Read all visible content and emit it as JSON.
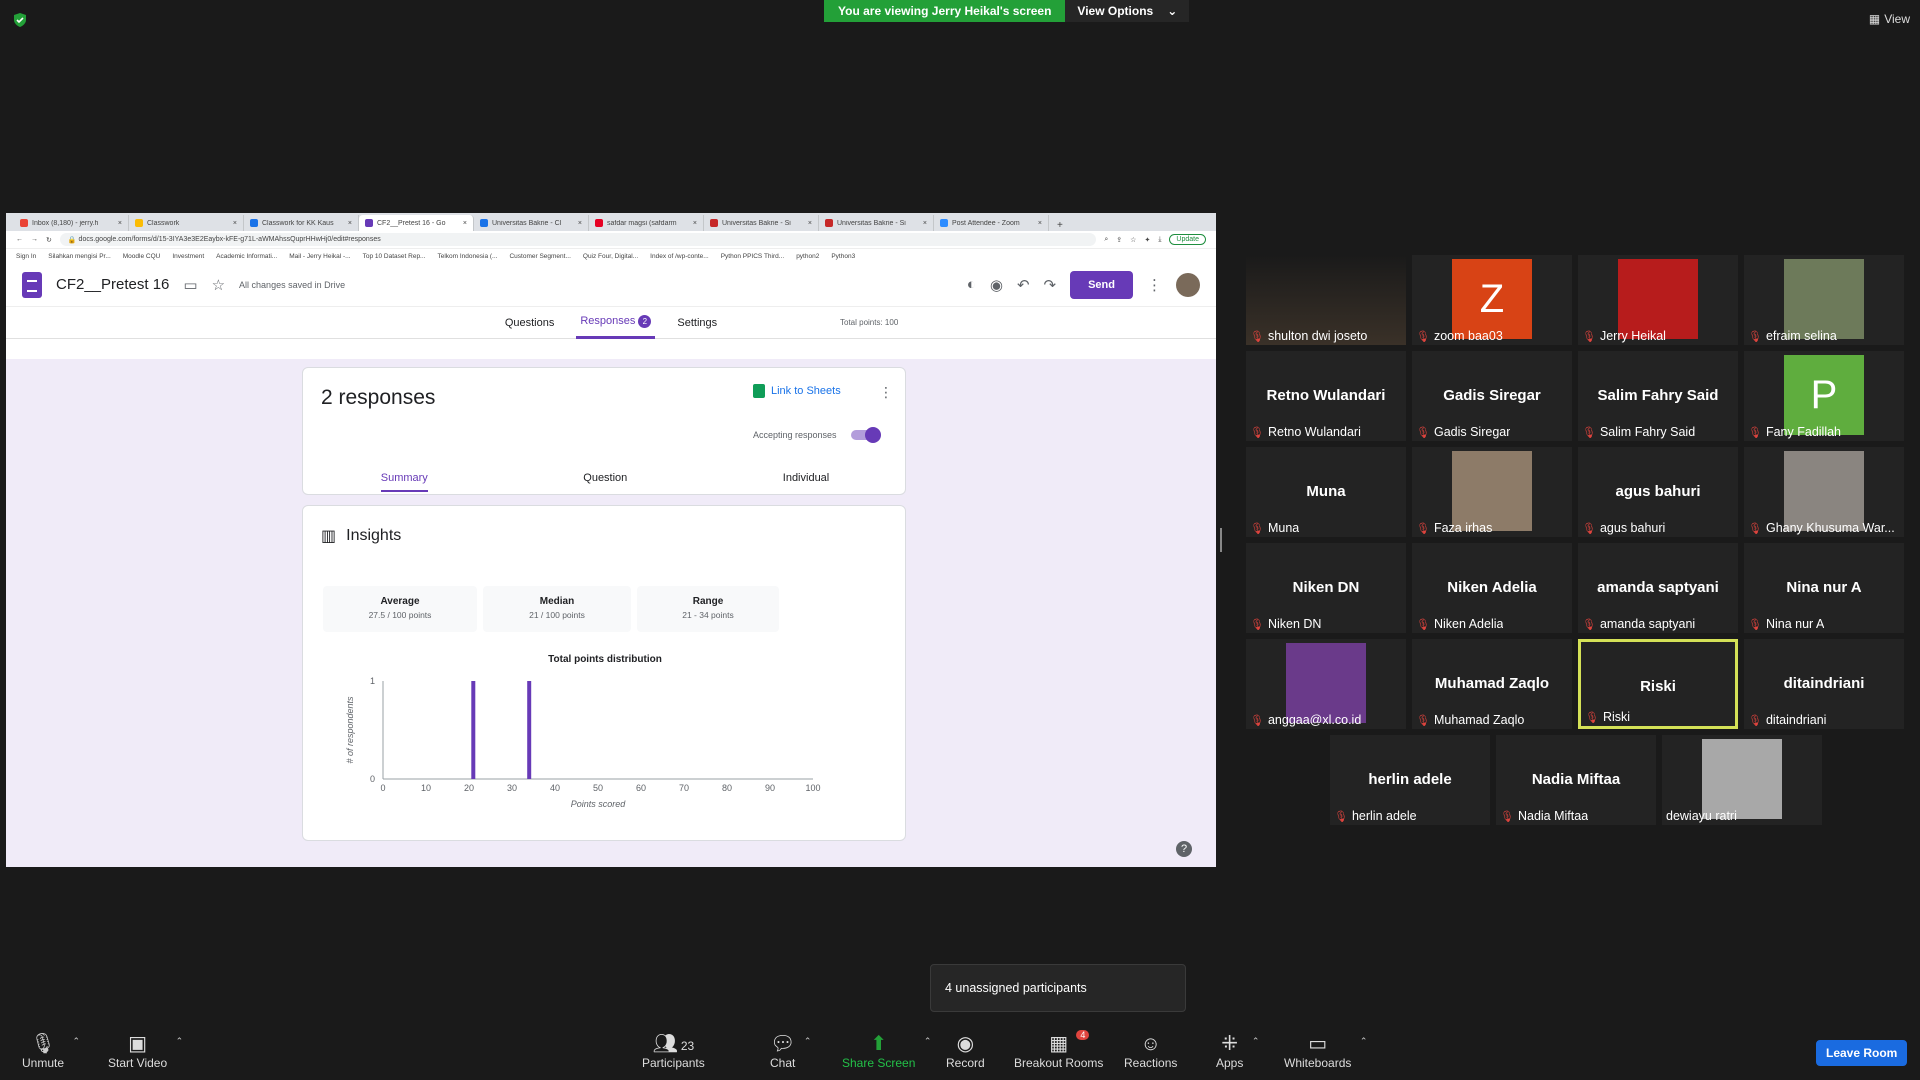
{
  "colors": {
    "zoom_green": "#23a038",
    "forms_purple": "#673ab7",
    "speaker_border": "#d4e157",
    "leave_blue": "#1a6be0",
    "mic_red": "#e0443e"
  },
  "banner": {
    "viewing": "You are viewing Jerry Heikal's screen",
    "view_options": "View Options",
    "view": "View"
  },
  "browser": {
    "tabs": [
      {
        "label": "Inbox (8,180) - jerry.h",
        "fav_color": "#ea4335"
      },
      {
        "label": "Classwork",
        "fav_color": "#fbbc04"
      },
      {
        "label": "Classwork for KK Kaus",
        "fav_color": "#1a73e8"
      },
      {
        "label": "CF2__Pretest 16 - Go",
        "fav_color": "#673ab7"
      },
      {
        "label": "Universitas Bakrie - Cl",
        "fav_color": "#1a73e8"
      },
      {
        "label": "safdar magsi (safdarm",
        "fav_color": "#e60023"
      },
      {
        "label": "Universitas Bakrie - Si",
        "fav_color": "#c62828"
      },
      {
        "label": "Universitas Bakrie - Si",
        "fav_color": "#c62828"
      },
      {
        "label": "Post Attendee - Zoom",
        "fav_color": "#2d8cff"
      }
    ],
    "url": "docs.google.com/forms/d/15-3IYA3e3E2Eaybx-kFE-g71L-aWMAhssQuprHHwHj0/edit#responses",
    "update_label": "Update",
    "bookmarks": [
      "Sign In",
      "Silahkan mengisi Pr...",
      "Moodle CQU",
      "Investment",
      "Academic Informati...",
      "Mail - Jerry Heikal -...",
      "Top 10 Dataset Rep...",
      "Telkom Indonesia (...",
      "Customer Segment...",
      "Quiz Four, Digital...",
      "Index of /wp-conte...",
      "Python PPICS Third...",
      "python2",
      "Python3"
    ]
  },
  "forms": {
    "title": "CF2__Pretest 16",
    "saved": "All changes saved in Drive",
    "send": "Send",
    "tabs": {
      "questions": "Questions",
      "responses": "Responses",
      "responses_count": "2",
      "settings": "Settings"
    },
    "total_points": "Total points: 100",
    "responses_title": "2 responses",
    "link_sheets": "Link to Sheets",
    "accepting": "Accepting responses",
    "subtabs": {
      "summary": "Summary",
      "question": "Question",
      "individual": "Individual"
    },
    "insights": "Insights",
    "stats": [
      {
        "label": "Average",
        "value": "27.5 / 100 points"
      },
      {
        "label": "Median",
        "value": "21 / 100 points"
      },
      {
        "label": "Range",
        "value": "21 - 34 points"
      }
    ]
  },
  "chart_data": {
    "type": "bar",
    "title": "Total points distribution",
    "xlabel": "Points scored",
    "ylabel": "# of respondents",
    "x_ticks": [
      0,
      10,
      20,
      30,
      40,
      50,
      60,
      70,
      80,
      90,
      100
    ],
    "y_ticks": [
      0,
      1
    ],
    "xlim": [
      0,
      100
    ],
    "ylim": [
      0,
      1
    ],
    "points": [
      {
        "x": 21,
        "y": 1
      },
      {
        "x": 34,
        "y": 1
      }
    ],
    "color": "#673ab7"
  },
  "participants": [
    {
      "caption": "shulton dwi joseto",
      "kind": "video",
      "bg": "#3a3a3a"
    },
    {
      "caption": "zoom baa03",
      "kind": "letter",
      "letter": "Z",
      "bg": "#d84315"
    },
    {
      "caption": "Jerry Heikal",
      "kind": "image",
      "bg": "#b71c1c"
    },
    {
      "caption": "efraim selina",
      "kind": "image",
      "bg": "#6d7a5a"
    },
    {
      "caption": "Retno Wulandari",
      "name": "Retno Wulandari",
      "kind": "name"
    },
    {
      "caption": "Gadis Siregar",
      "name": "Gadis Siregar",
      "kind": "name"
    },
    {
      "caption": "Salim Fahry Said",
      "name": "Salim Fahry Said",
      "kind": "name"
    },
    {
      "caption": "Fany Fadillah",
      "kind": "letter",
      "letter": "P",
      "bg": "#5fad3e"
    },
    {
      "caption": "Muna",
      "name": "Muna",
      "kind": "name"
    },
    {
      "caption": "Faza irhas",
      "kind": "image",
      "bg": "#8d7b68"
    },
    {
      "caption": "agus bahuri",
      "name": "agus bahuri",
      "kind": "name"
    },
    {
      "caption": "Ghany Khusuma War...",
      "kind": "image",
      "bg": "#8a8580"
    },
    {
      "caption": "Niken DN",
      "name": "Niken DN",
      "kind": "name"
    },
    {
      "caption": "Niken Adelia",
      "name": "Niken Adelia",
      "kind": "name"
    },
    {
      "caption": "amanda saptyani",
      "name": "amanda saptyani",
      "kind": "name"
    },
    {
      "caption": "Nina nur A",
      "name": "Nina nur A",
      "kind": "name"
    },
    {
      "caption": "anggaa@xl.co.id",
      "kind": "image",
      "bg": "#6a3a8a"
    },
    {
      "caption": "Muhamad Zaqlo",
      "name": "Muhamad Zaqlo",
      "kind": "name"
    },
    {
      "caption": "Riski",
      "name": "Riski",
      "kind": "name",
      "speaking": true
    },
    {
      "caption": "ditaindriani",
      "name": "ditaindriani",
      "kind": "name"
    },
    {
      "caption": "herlin adele",
      "name": "herlin adele",
      "kind": "name"
    },
    {
      "caption": "Nadia Miftaa",
      "name": "Nadia Miftaa",
      "kind": "name"
    },
    {
      "caption": "dewiayu ratri",
      "kind": "image",
      "bg": "#a8a8a8",
      "mic_on": true
    }
  ],
  "popover": {
    "unassigned": "4 unassigned participants"
  },
  "toolbar": {
    "unmute": "Unmute",
    "start_video": "Start Video",
    "participants": "Participants",
    "participants_count": "23",
    "chat": "Chat",
    "share_screen": "Share Screen",
    "record": "Record",
    "breakout": "Breakout Rooms",
    "breakout_badge": "4",
    "reactions": "Reactions",
    "apps": "Apps",
    "whiteboards": "Whiteboards",
    "leave": "Leave Room"
  }
}
